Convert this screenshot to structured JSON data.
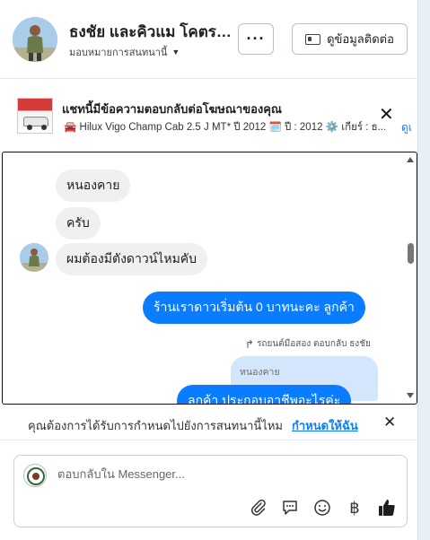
{
  "header": {
    "contact_name": "ธงชัย และคิวแม โคตรช...",
    "assign_label": "มอบหมายการสนทนานี้",
    "more_label": "···",
    "contact_info_label": "ดูข้อมูลติดต่อ"
  },
  "ad": {
    "title": "แชทนี้มีข้อความตอบกลับต่อโฆษณาของคุณ",
    "detail": "🚘 Hilux Vigo Champ Cab 2.5 J MT* ปี 2012 🗓️ ปี : 2012 ⚙️ เกียร์ : ธ...",
    "more_link": "ดูเ"
  },
  "messages": {
    "in": [
      "หนองคาย",
      "ครับ",
      "ผมต้องมีตังดาวน์ไหมคับ"
    ],
    "out_1": "ร้านเราดาวเริ่มต้น 0 บาทนะคะ  ลูกค้า",
    "reply_meta": "รถยนต์มือสอง ตอบกลับ ธงชัย",
    "quoted": "หนองคาย",
    "out_2": "ลูกค้า ประกอบอาชีพอะไรค่ะ"
  },
  "assign_prompt": {
    "text": "คุณต้องการได้รับการกำหนดไปยังการสนทนานี้ไหม",
    "link": "กำหนดให้ฉัน"
  },
  "composer": {
    "placeholder": "ตอบกลับใน Messenger...",
    "currency": "฿"
  },
  "colors": {
    "accent": "#0a7cff",
    "incoming_bubble": "#f0f0f0",
    "quote_bubble": "#d4e6fb"
  }
}
